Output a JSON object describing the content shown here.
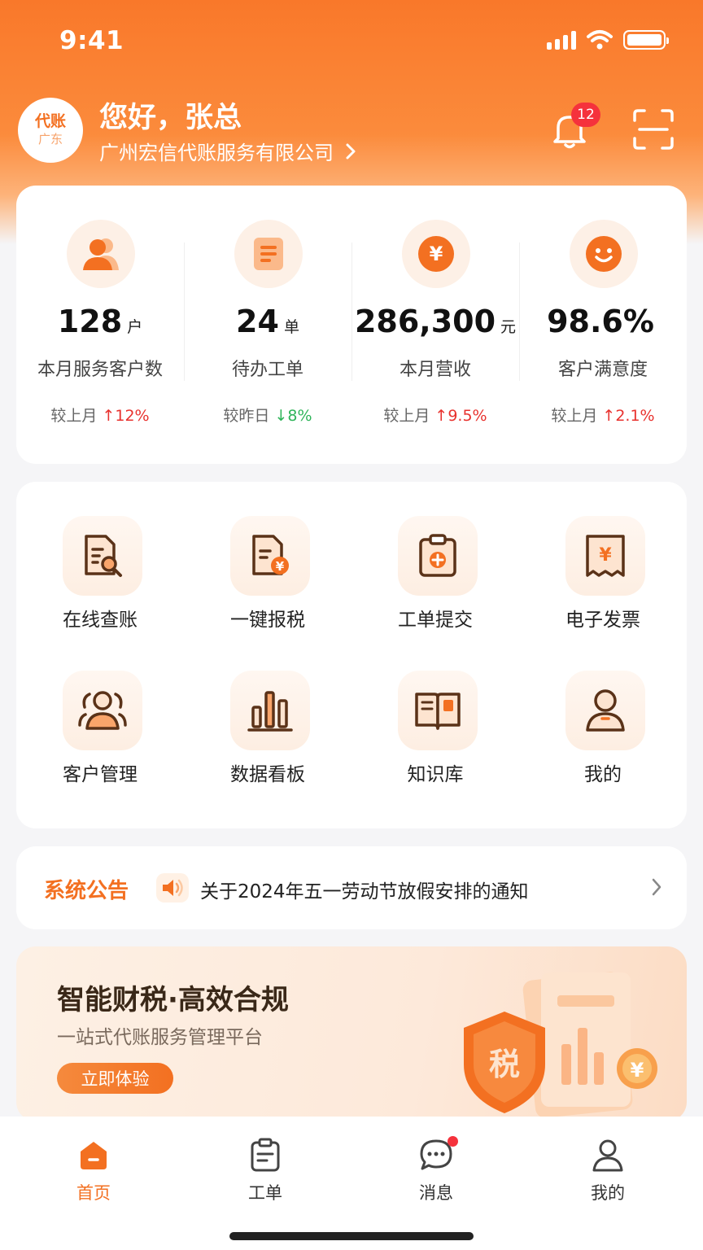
{
  "status_bar": {
    "time": "9:41"
  },
  "header": {
    "avatar_text": "代账",
    "avatar_subtext": "广东",
    "greeting": "您好，张总",
    "company": "广州宏信代账服务有限公司",
    "notification_count": "12"
  },
  "stats": [
    {
      "icon": "users-icon",
      "value": "128",
      "unit": "户",
      "label": "本月服务客户数",
      "compare_label": "较上月",
      "direction": "up",
      "change": "12%"
    },
    {
      "icon": "document-list-icon",
      "value": "24",
      "unit": "单",
      "label": "待办工单",
      "compare_label": "较昨日",
      "direction": "down",
      "change": "8%"
    },
    {
      "icon": "yuan-coin-icon",
      "value": "286,300",
      "unit": "元",
      "label": "本月营收",
      "compare_label": "较上月",
      "direction": "up",
      "change": "9.5%"
    },
    {
      "icon": "smile-icon",
      "value": "98.6%",
      "unit": "",
      "label": "客户满意度",
      "compare_label": "较上月",
      "direction": "up",
      "change": "2.1%"
    }
  ],
  "arrows": {
    "up": "↑",
    "down": "↓"
  },
  "apps": [
    {
      "icon": "document-search-icon",
      "label": "在线查账"
    },
    {
      "icon": "tax-document-icon",
      "label": "一键报税"
    },
    {
      "icon": "clipboard-add-icon",
      "label": "工单提交"
    },
    {
      "icon": "invoice-icon",
      "label": "电子发票"
    },
    {
      "icon": "customers-icon",
      "label": "客户管理"
    },
    {
      "icon": "bar-chart-icon",
      "label": "数据看板"
    },
    {
      "icon": "book-icon",
      "label": "知识库"
    },
    {
      "icon": "person-icon",
      "label": "我的"
    }
  ],
  "notice": {
    "title": "系统公告",
    "text": "关于2024年五一劳动节放假安排的通知"
  },
  "banner": {
    "title": "智能财税·高效合规",
    "subtitle": "一站式代账服务管理平台",
    "button": "立即体验",
    "shield_text": "税",
    "coin_text": "¥"
  },
  "tabbar": [
    {
      "icon": "home-icon",
      "label": "首页",
      "active": true
    },
    {
      "icon": "work-order-icon",
      "label": "工单",
      "active": false
    },
    {
      "icon": "message-icon",
      "label": "消息",
      "active": false
    },
    {
      "icon": "profile-icon",
      "label": "我的",
      "active": false
    }
  ],
  "colors": {
    "brand": "#f37021",
    "up": "#e8322e",
    "down": "#2fb45a",
    "badge": "#f5323c"
  }
}
